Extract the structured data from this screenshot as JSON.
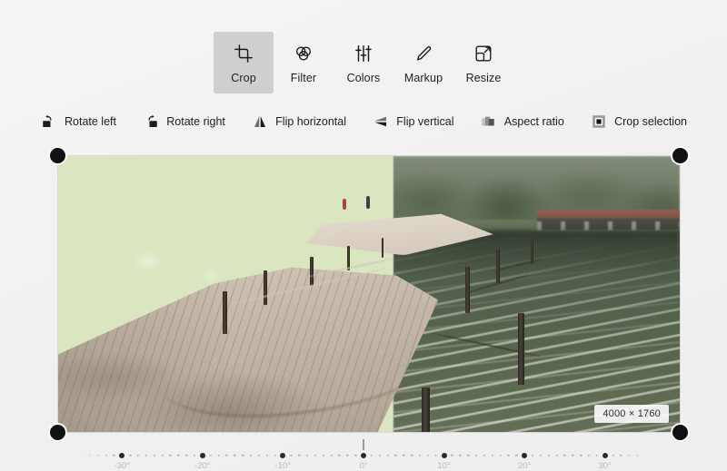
{
  "toolbar": {
    "tools": [
      {
        "id": "crop",
        "label": "Crop",
        "icon": "crop-icon",
        "active": true
      },
      {
        "id": "filter",
        "label": "Filter",
        "icon": "filter-icon",
        "active": false
      },
      {
        "id": "colors",
        "label": "Colors",
        "icon": "colors-icon",
        "active": false
      },
      {
        "id": "markup",
        "label": "Markup",
        "icon": "markup-icon",
        "active": false
      },
      {
        "id": "resize",
        "label": "Resize",
        "icon": "resize-icon",
        "active": false
      }
    ]
  },
  "actions": [
    {
      "id": "rotate-left",
      "label": "Rotate left",
      "icon": "rotate-left-icon"
    },
    {
      "id": "rotate-right",
      "label": "Rotate right",
      "icon": "rotate-right-icon"
    },
    {
      "id": "flip-horizontal",
      "label": "Flip horizontal",
      "icon": "flip-horizontal-icon"
    },
    {
      "id": "flip-vertical",
      "label": "Flip vertical",
      "icon": "flip-vertical-icon"
    },
    {
      "id": "aspect-ratio",
      "label": "Aspect ratio",
      "icon": "aspect-ratio-icon"
    },
    {
      "id": "crop-selection",
      "label": "Crop selection",
      "icon": "crop-selection-icon"
    }
  ],
  "canvas": {
    "size_badge": "4000 × 1760",
    "photo_description": "Wooden boardwalk along a lake with dense green foliage on the left, rippled water on the right and a distant bridge",
    "handles": [
      "top-left",
      "top-right",
      "bottom-left",
      "bottom-right"
    ]
  },
  "rotation_ruler": {
    "value": "0",
    "unit": "°",
    "labels": [
      "-30°",
      "-20°",
      "-10°",
      "0°",
      "10°",
      "20°",
      "30°"
    ],
    "min": -35,
    "max": 35
  },
  "colors": {
    "background": "#f2f2f2",
    "active_tool_bg": "#cfcfcf",
    "handle": "#111111",
    "text": "#1c1c1c",
    "ruler_label": "#b9b9b9"
  }
}
